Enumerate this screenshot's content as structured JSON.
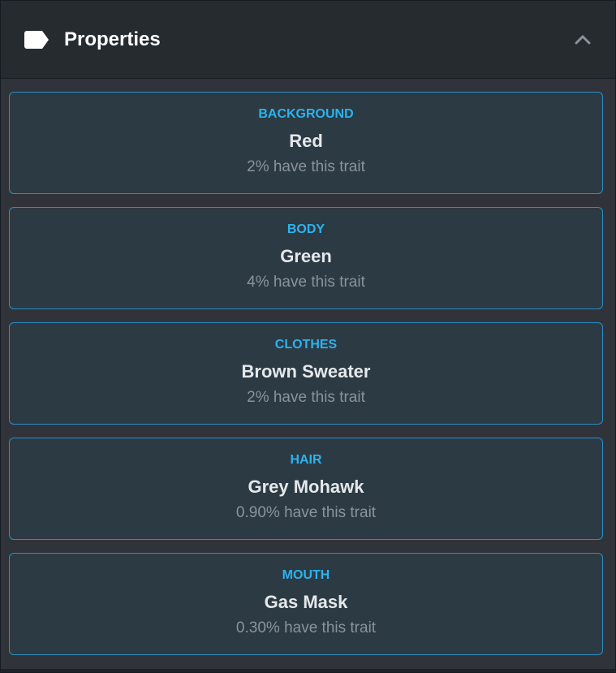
{
  "header": {
    "title": "Properties",
    "icon": "tag-icon",
    "toggle_icon": "chevron-up-icon"
  },
  "colors": {
    "accent": "#2bb3ee",
    "border": "#2a8fc8",
    "card_bg": "#2c3a44",
    "header_bg": "#262b2f"
  },
  "traits": [
    {
      "type": "BACKGROUND",
      "value": "Red",
      "rarity": "2% have this trait"
    },
    {
      "type": "BODY",
      "value": "Green",
      "rarity": "4% have this trait"
    },
    {
      "type": "CLOTHES",
      "value": "Brown Sweater",
      "rarity": "2% have this trait"
    },
    {
      "type": "HAIR",
      "value": "Grey Mohawk",
      "rarity": "0.90% have this trait"
    },
    {
      "type": "MOUTH",
      "value": "Gas Mask",
      "rarity": "0.30% have this trait"
    }
  ]
}
